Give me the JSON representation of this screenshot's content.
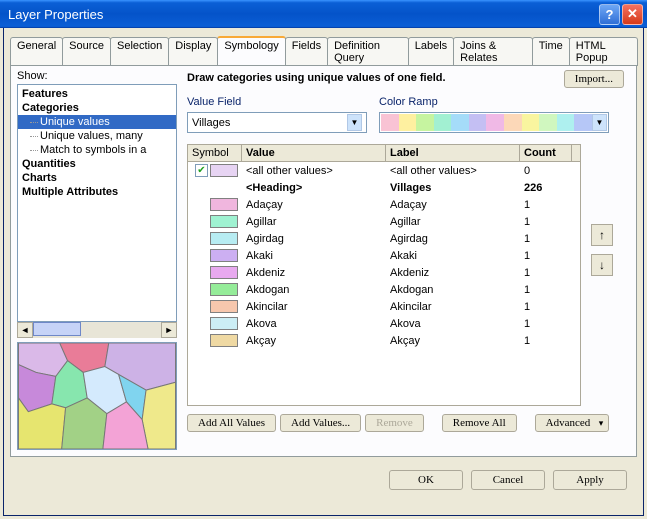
{
  "window": {
    "title": "Layer Properties"
  },
  "tabs": [
    "General",
    "Source",
    "Selection",
    "Display",
    "Symbology",
    "Fields",
    "Definition Query",
    "Labels",
    "Joins & Relates",
    "Time",
    "HTML Popup"
  ],
  "active_tab_index": 4,
  "show_label": "Show:",
  "show_tree": {
    "features": "Features",
    "categories": "Categories",
    "cat_children": [
      "Unique values",
      "Unique values, many",
      "Match to symbols in a"
    ],
    "cat_selected_index": 0,
    "quantities": "Quantities",
    "charts": "Charts",
    "multi_attr": "Multiple Attributes"
  },
  "desc": "Draw categories using unique values of one field.",
  "import_label": "Import...",
  "value_field_label": "Value Field",
  "value_field_value": "Villages",
  "color_ramp_label": "Color Ramp",
  "ramp_colors": [
    "#f9c3d4",
    "#fef0a0",
    "#c6f4a0",
    "#a2f0d2",
    "#a5dcf9",
    "#c4bff3",
    "#f0b9e6",
    "#fcd8b8",
    "#f9f59f",
    "#d0f7bf",
    "#aef0ef",
    "#b6c7f7"
  ],
  "grid": {
    "headers": {
      "symbol": "Symbol",
      "value": "Value",
      "label": "Label",
      "count": "Count"
    },
    "rows": [
      {
        "checked": true,
        "color": "#e7d4f3",
        "value": "<all other values>",
        "label": "<all other values>",
        "count": "0",
        "checkbox": true
      },
      {
        "heading": true,
        "value": "<Heading>",
        "label": "Villages",
        "count": "226"
      },
      {
        "color": "#f0b6de",
        "value": "Adaçay",
        "label": "Adaçay",
        "count": "1"
      },
      {
        "color": "#9ff2d1",
        "value": "Agillar",
        "label": "Agillar",
        "count": "1"
      },
      {
        "color": "#b7ecf2",
        "value": "Agirdag",
        "label": "Agirdag",
        "count": "1"
      },
      {
        "color": "#ccaff2",
        "value": "Akaki",
        "label": "Akaki",
        "count": "1"
      },
      {
        "color": "#e8a9ef",
        "value": "Akdeniz",
        "label": "Akdeniz",
        "count": "1"
      },
      {
        "color": "#95ec99",
        "value": "Akdogan",
        "label": "Akdogan",
        "count": "1"
      },
      {
        "color": "#f7c7ad",
        "value": "Akincilar",
        "label": "Akincilar",
        "count": "1"
      },
      {
        "color": "#cceef5",
        "value": "Akova",
        "label": "Akova",
        "count": "1"
      },
      {
        "color": "#efd9a3",
        "value": "Akçay",
        "label": "Akçay",
        "count": "1"
      }
    ]
  },
  "buttons": {
    "add_all": "Add All Values",
    "add_values": "Add Values...",
    "remove": "Remove",
    "remove_all": "Remove All",
    "advanced": "Advanced",
    "ok": "OK",
    "cancel": "Cancel",
    "apply": "Apply"
  }
}
